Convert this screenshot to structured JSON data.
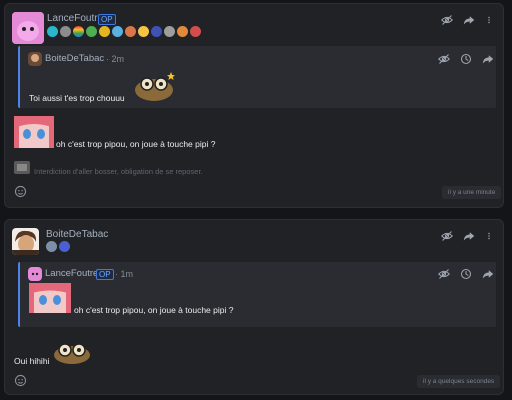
{
  "colors": {
    "background": "#141518",
    "card": "#202226",
    "quote_bar": "#4d82e8",
    "username": "#a5b0c0",
    "op_badge": "#3f79e0"
  },
  "posts": [
    {
      "author": "LanceFoutre",
      "op_badge": "OP",
      "badges": [
        "badge-icon",
        "badge-icon",
        "badge-icon",
        "badge-icon",
        "badge-icon",
        "badge-icon",
        "badge-icon",
        "badge-icon",
        "badge-icon",
        "badge-icon",
        "badge-icon",
        "badge-icon"
      ],
      "actions": [
        "hide-eye-icon",
        "share-arrow-icon",
        "more-dots-icon"
      ],
      "quote": {
        "author": "BoiteDeTabac",
        "time": "· 2m",
        "text": "Toi aussi t'es trop chouuu",
        "actions": [
          "hide-eye-icon",
          "history-icon",
          "share-arrow-icon"
        ]
      },
      "text": "oh c'est trop pipou, on joue à touche pipi ?",
      "signature": "Interdiction d'aller bosser, obligation de se reposer.",
      "timestamp": "il y a une minute",
      "reaction_icon": "add-reaction-icon"
    },
    {
      "author": "BoiteDeTabac",
      "badges": [
        "badge-icon",
        "badge-icon"
      ],
      "actions": [
        "hide-eye-icon",
        "share-arrow-icon",
        "more-dots-icon"
      ],
      "quote": {
        "author": "LanceFoutre",
        "op_badge": "OP",
        "time": "· 1m",
        "text": "oh c'est trop pipou, on joue à touche pipi ?",
        "actions": [
          "hide-eye-icon",
          "history-icon",
          "share-arrow-icon"
        ]
      },
      "text": "Oui hihihi",
      "timestamp": "il y a quelques secondes",
      "reaction_icon": "add-reaction-icon"
    }
  ]
}
